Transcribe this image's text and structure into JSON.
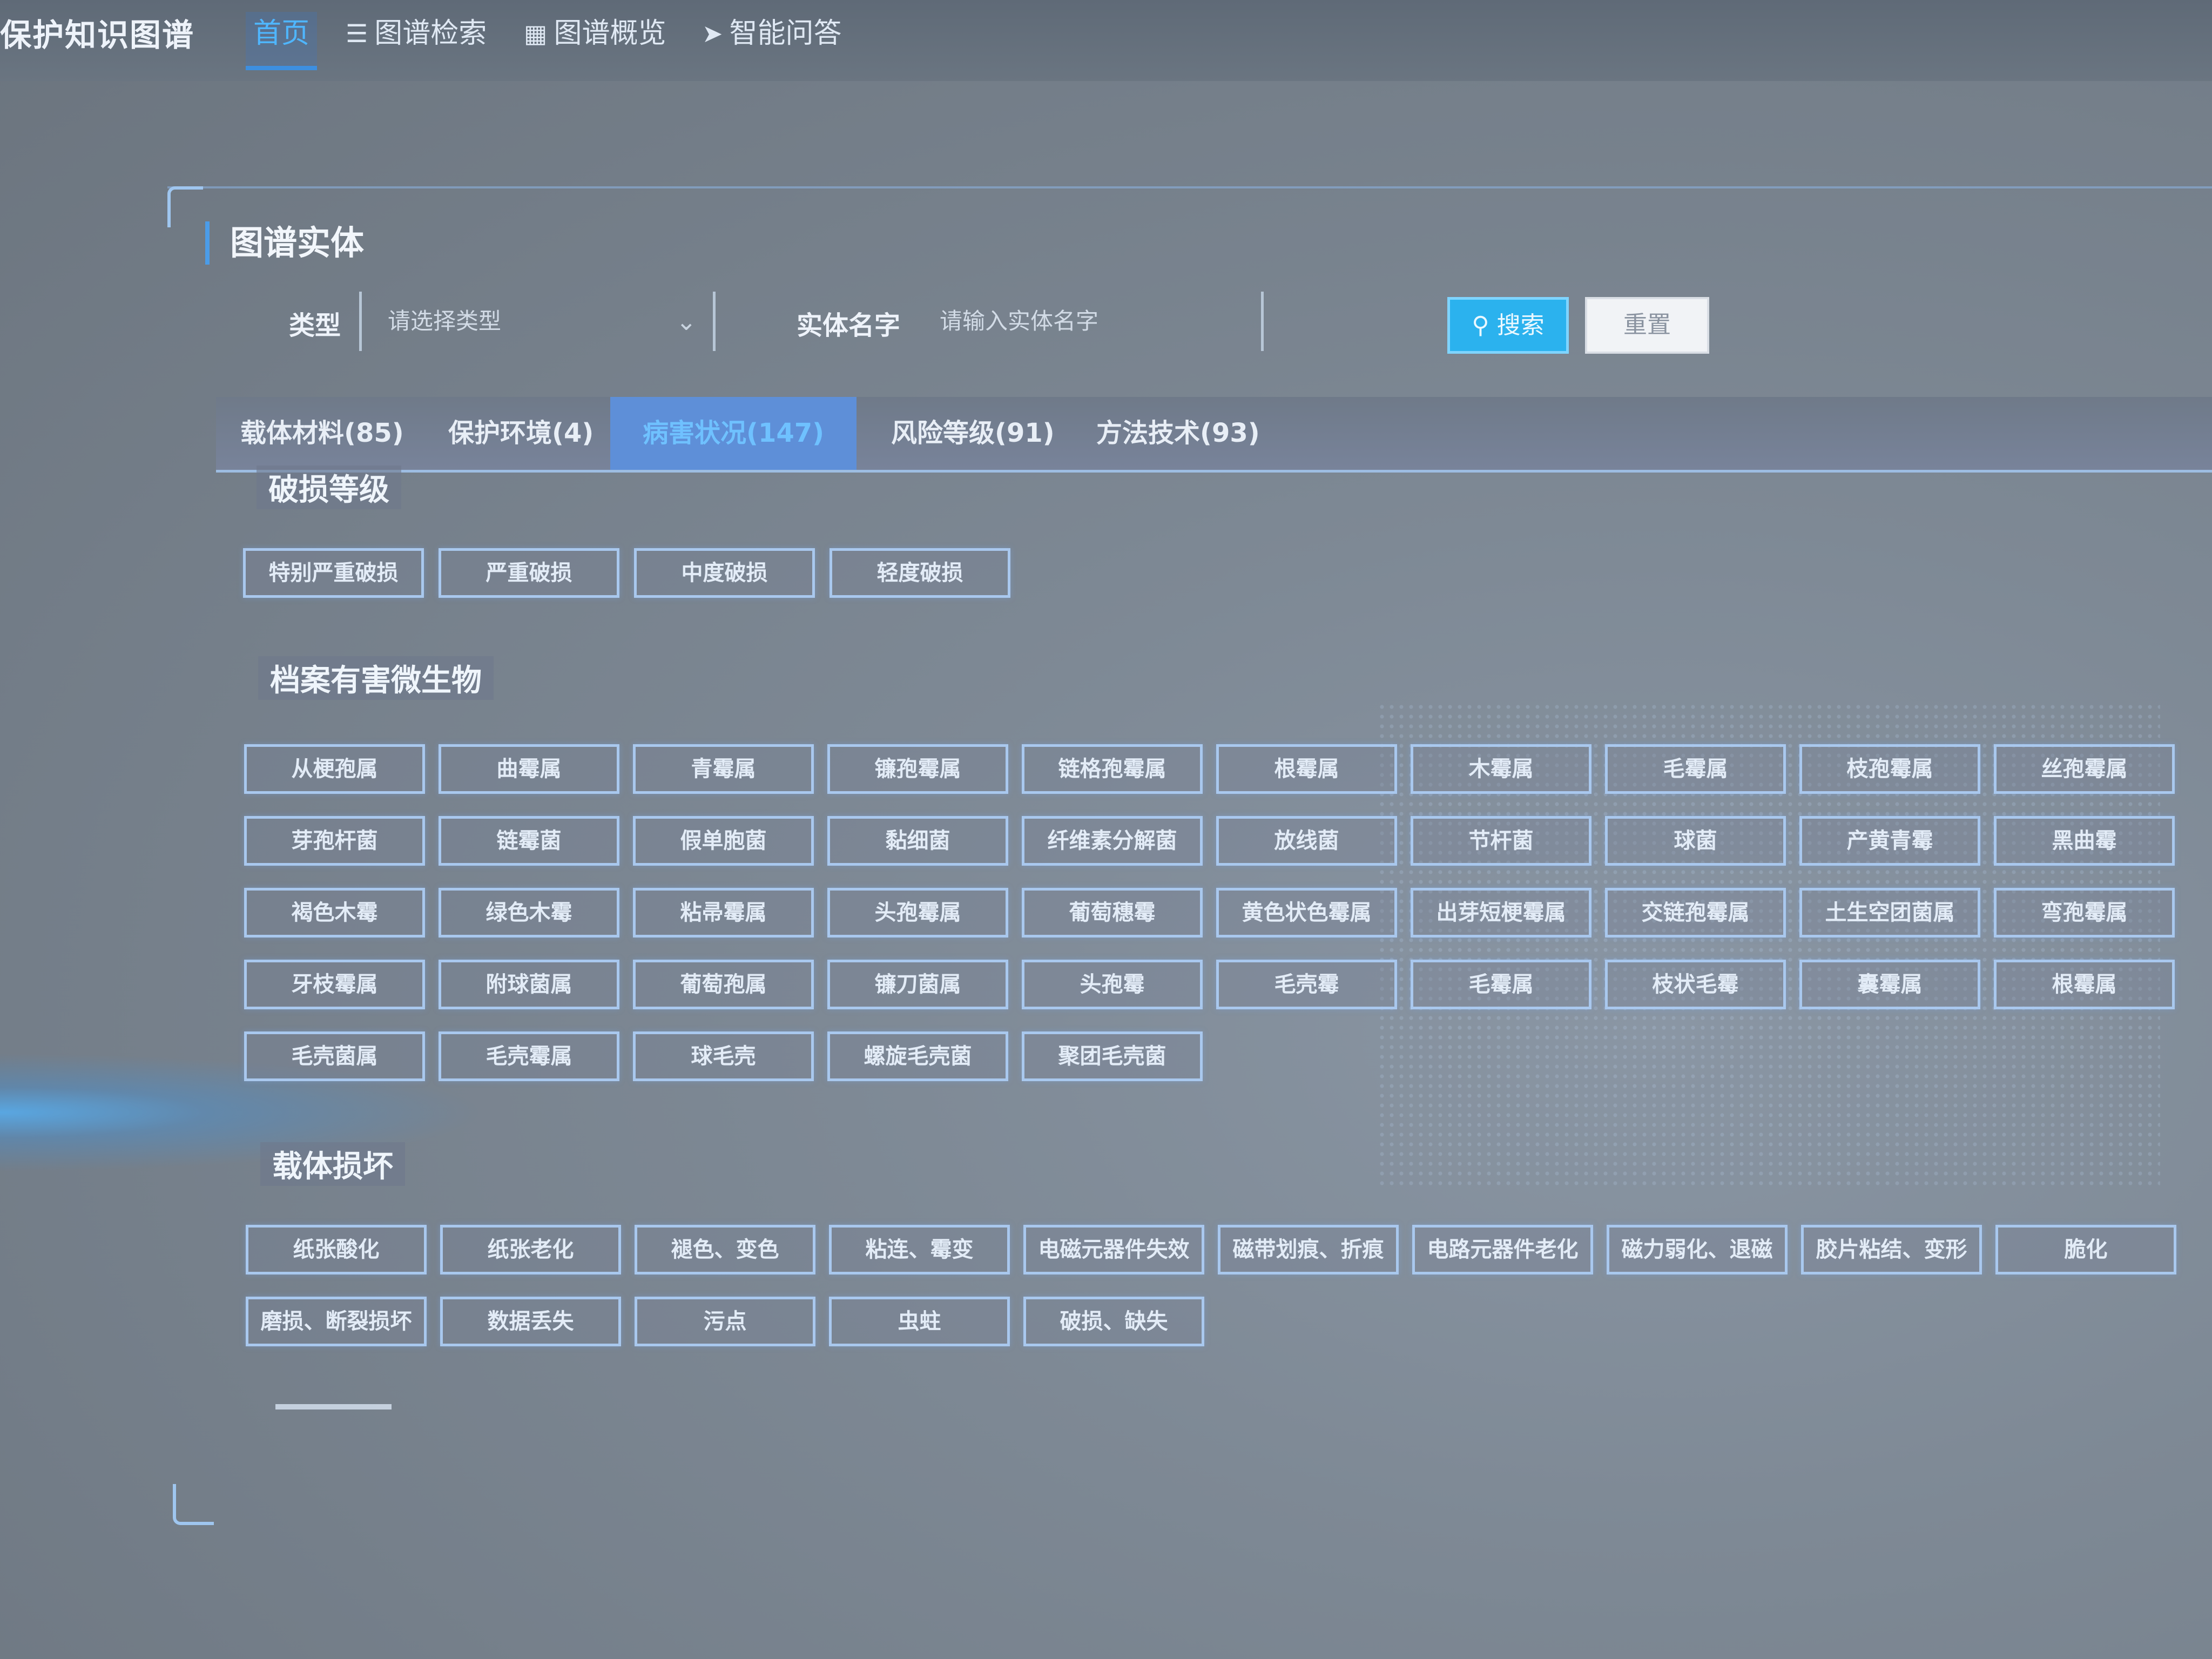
{
  "app": {
    "title": "保护知识图谱"
  },
  "nav": [
    {
      "label": "首页",
      "icon": "",
      "active": true
    },
    {
      "label": "图谱检索",
      "icon": "☰",
      "active": false
    },
    {
      "label": "图谱概览",
      "icon": "▦",
      "active": false
    },
    {
      "label": "智能问答",
      "icon": "➤",
      "active": false
    }
  ],
  "panel": {
    "title": "图谱实体"
  },
  "filter": {
    "type_label": "类型",
    "type_placeholder": "请选择类型",
    "name_label": "实体名字",
    "name_placeholder": "请输入实体名字",
    "search_label": "搜索",
    "reset_label": "重置"
  },
  "tabs": [
    {
      "label": "载体材料(85)",
      "active": false
    },
    {
      "label": "保护环境(4)",
      "active": false
    },
    {
      "label": "病害状况(147)",
      "active": true
    },
    {
      "label": "风险等级(91)",
      "active": false
    },
    {
      "label": "方法技术(93)",
      "active": false
    }
  ],
  "groups": [
    {
      "title": "破损等级",
      "items": [
        "特别严重破损",
        "严重破损",
        "中度破损",
        "轻度破损"
      ]
    },
    {
      "title": "档案有害微生物",
      "items": [
        "从梗孢属",
        "曲霉属",
        "青霉属",
        "镰孢霉属",
        "链格孢霉属",
        "根霉属",
        "木霉属",
        "毛霉属",
        "枝孢霉属",
        "丝孢霉属",
        "芽孢杆菌",
        "链霉菌",
        "假单胞菌",
        "黏细菌",
        "纤维素分解菌",
        "放线菌",
        "节杆菌",
        "球菌",
        "产黄青霉",
        "黑曲霉",
        "褐色木霉",
        "绿色木霉",
        "粘帚霉属",
        "头孢霉属",
        "葡萄穗霉",
        "黄色状色霉属",
        "出芽短梗霉属",
        "交链孢霉属",
        "土生空团菌属",
        "弯孢霉属",
        "牙枝霉属",
        "附球菌属",
        "葡萄孢属",
        "镰刀菌属",
        "头孢霉",
        "毛壳霉",
        "毛霉属",
        "枝状毛霉",
        "囊霉属",
        "根霉属",
        "毛壳菌属",
        "毛壳霉属",
        "球毛壳",
        "螺旋毛壳菌",
        "聚团毛壳菌"
      ]
    },
    {
      "title": "载体损坏",
      "items": [
        "纸张酸化",
        "纸张老化",
        "褪色、变色",
        "粘连、霉变",
        "电磁元器件失效",
        "磁带划痕、折痕",
        "电路元器件老化",
        "磁力弱化、退磁",
        "胶片粘结、变形",
        "脆化",
        "磨损、断裂损坏",
        "数据丢失",
        "污点",
        "虫蛀",
        "破损、缺失"
      ]
    }
  ]
}
